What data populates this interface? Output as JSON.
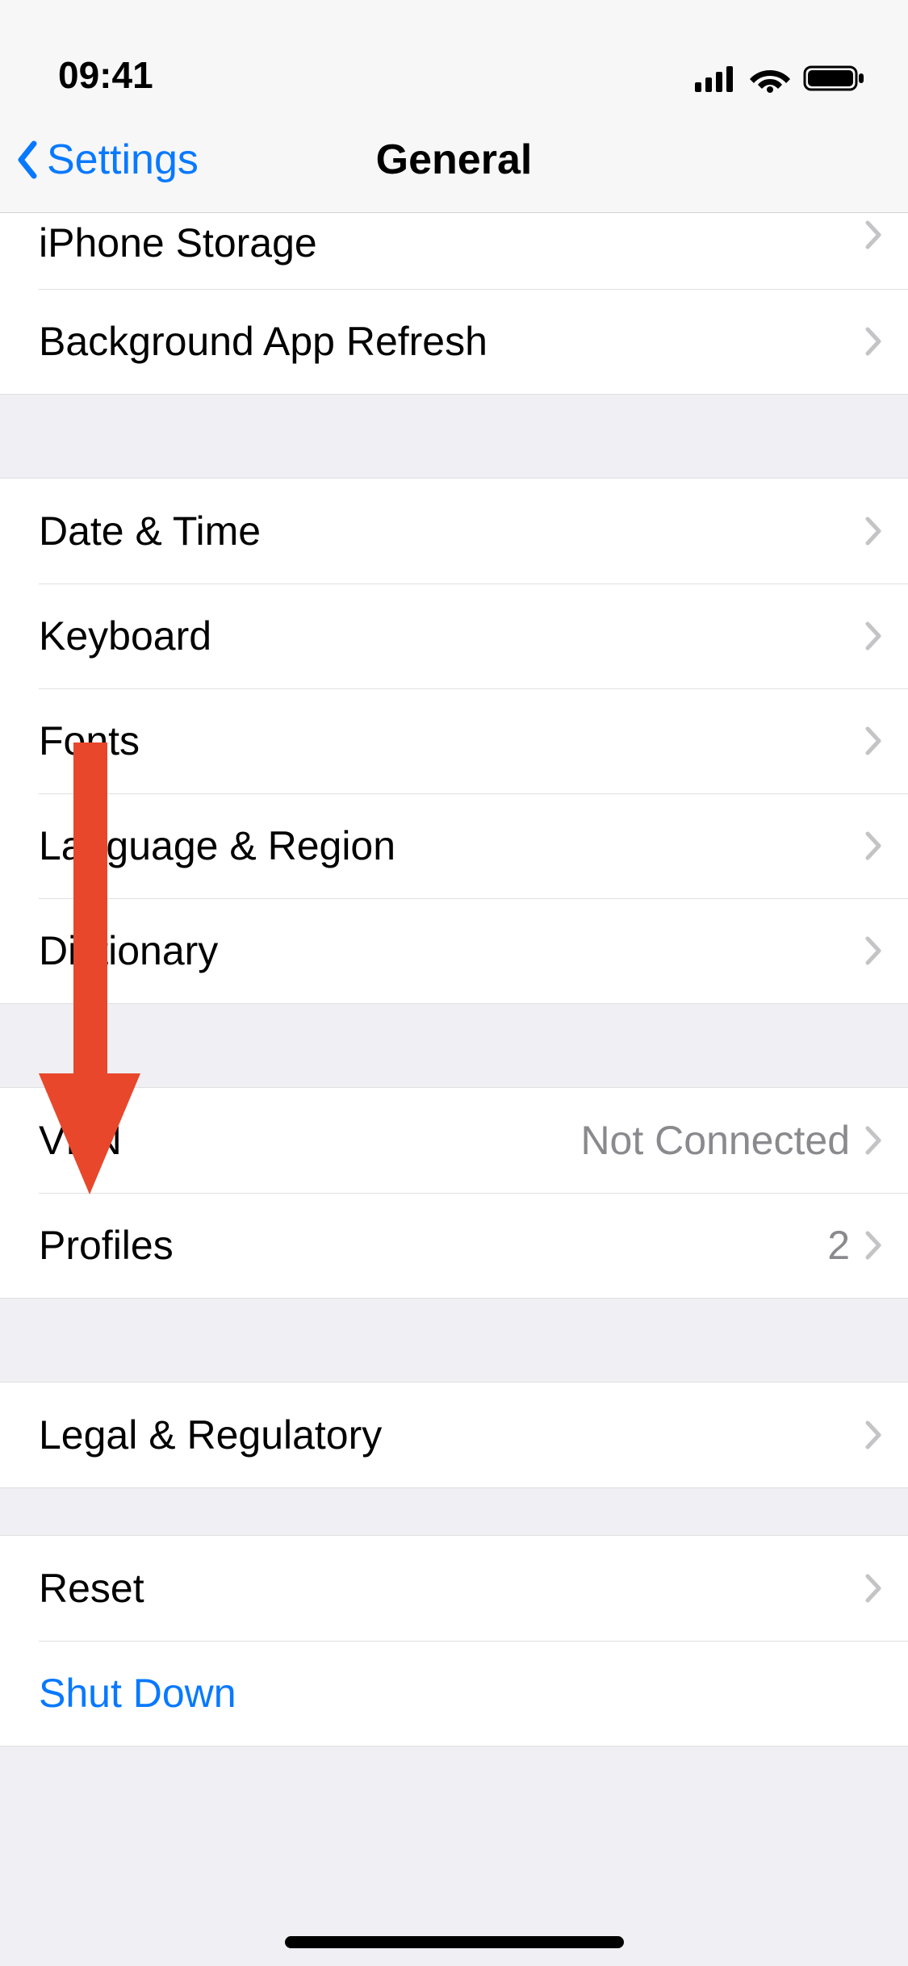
{
  "status": {
    "time": "09:41"
  },
  "nav": {
    "back": "Settings",
    "title": "General"
  },
  "groups": [
    {
      "type": "group",
      "first": true,
      "rows": [
        {
          "key": "iphone-storage",
          "label": "iPhone Storage",
          "chevron": true
        },
        {
          "key": "background-app-refresh",
          "label": "Background App Refresh",
          "chevron": true
        }
      ]
    },
    {
      "type": "gap"
    },
    {
      "type": "group",
      "rows": [
        {
          "key": "date-time",
          "label": "Date & Time",
          "chevron": true
        },
        {
          "key": "keyboard",
          "label": "Keyboard",
          "chevron": true
        },
        {
          "key": "fonts",
          "label": "Fonts",
          "chevron": true
        },
        {
          "key": "language-region",
          "label": "Language & Region",
          "chevron": true
        },
        {
          "key": "dictionary",
          "label": "Dictionary",
          "chevron": true
        }
      ]
    },
    {
      "type": "gap"
    },
    {
      "type": "group",
      "rows": [
        {
          "key": "vpn",
          "label": "VPN",
          "detail": "Not Connected",
          "chevron": true
        },
        {
          "key": "profiles",
          "label": "Profiles",
          "detail": "2",
          "chevron": true
        }
      ]
    },
    {
      "type": "gap"
    },
    {
      "type": "group",
      "rows": [
        {
          "key": "legal-regulatory",
          "label": "Legal & Regulatory",
          "chevron": true
        }
      ]
    },
    {
      "type": "gap-small"
    },
    {
      "type": "group",
      "rows": [
        {
          "key": "reset",
          "label": "Reset",
          "chevron": true
        },
        {
          "key": "shut-down",
          "label": "Shut Down",
          "chevron": false,
          "link": true
        }
      ]
    }
  ],
  "annotation": {
    "type": "arrow",
    "color": "#e8472b",
    "points_to": "profiles"
  }
}
